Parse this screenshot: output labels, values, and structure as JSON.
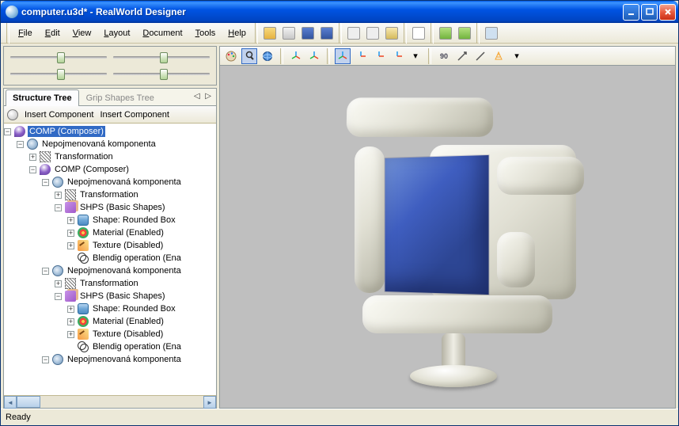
{
  "window": {
    "title": "computer.u3d* - RealWorld Designer"
  },
  "menus": {
    "file": "File",
    "edit": "Edit",
    "view": "View",
    "layout": "Layout",
    "document": "Document",
    "tools": "Tools",
    "help": "Help"
  },
  "tabs": {
    "active": "Structure Tree",
    "inactive": "Grip Shapes Tree",
    "arrows": "◁  ▷"
  },
  "treebar": {
    "ic1": "Insert Component",
    "ic2": "Insert Component"
  },
  "tree": {
    "root": "COMP (Composer)",
    "comp": "Nepojmenovaná komponenta",
    "transform": "Transformation",
    "composer": "COMP (Composer)",
    "shps": "SHPS (Basic Shapes)",
    "shape": "Shape: Rounded Box",
    "material": "Material (Enabled)",
    "texture": "Texture (Disabled)",
    "blend": "Blendig operation (Ena"
  },
  "status": {
    "text": "Ready"
  }
}
